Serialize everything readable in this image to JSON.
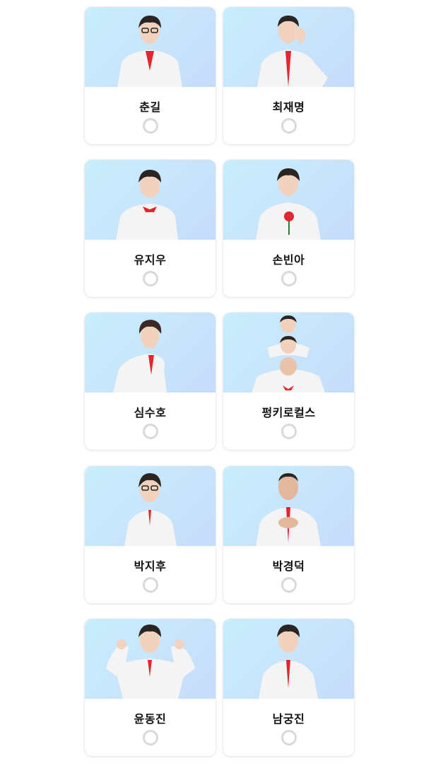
{
  "cards": [
    {
      "name": "춘길",
      "selected": false
    },
    {
      "name": "최재명",
      "selected": false
    },
    {
      "name": "유지우",
      "selected": false
    },
    {
      "name": "손빈아",
      "selected": false
    },
    {
      "name": "심수호",
      "selected": false
    },
    {
      "name": "펑키로컬스",
      "selected": false
    },
    {
      "name": "박지후",
      "selected": false
    },
    {
      "name": "박경덕",
      "selected": false
    },
    {
      "name": "윤동진",
      "selected": false
    },
    {
      "name": "남궁진",
      "selected": false
    }
  ],
  "colors": {
    "photo_bg_start": "#c9eefc",
    "photo_bg_end": "#c6dcfb",
    "suit": "#f4f4f4",
    "tie": "#e3262f",
    "hair": "#2a2422",
    "radio_border": "#d7d9dc"
  }
}
